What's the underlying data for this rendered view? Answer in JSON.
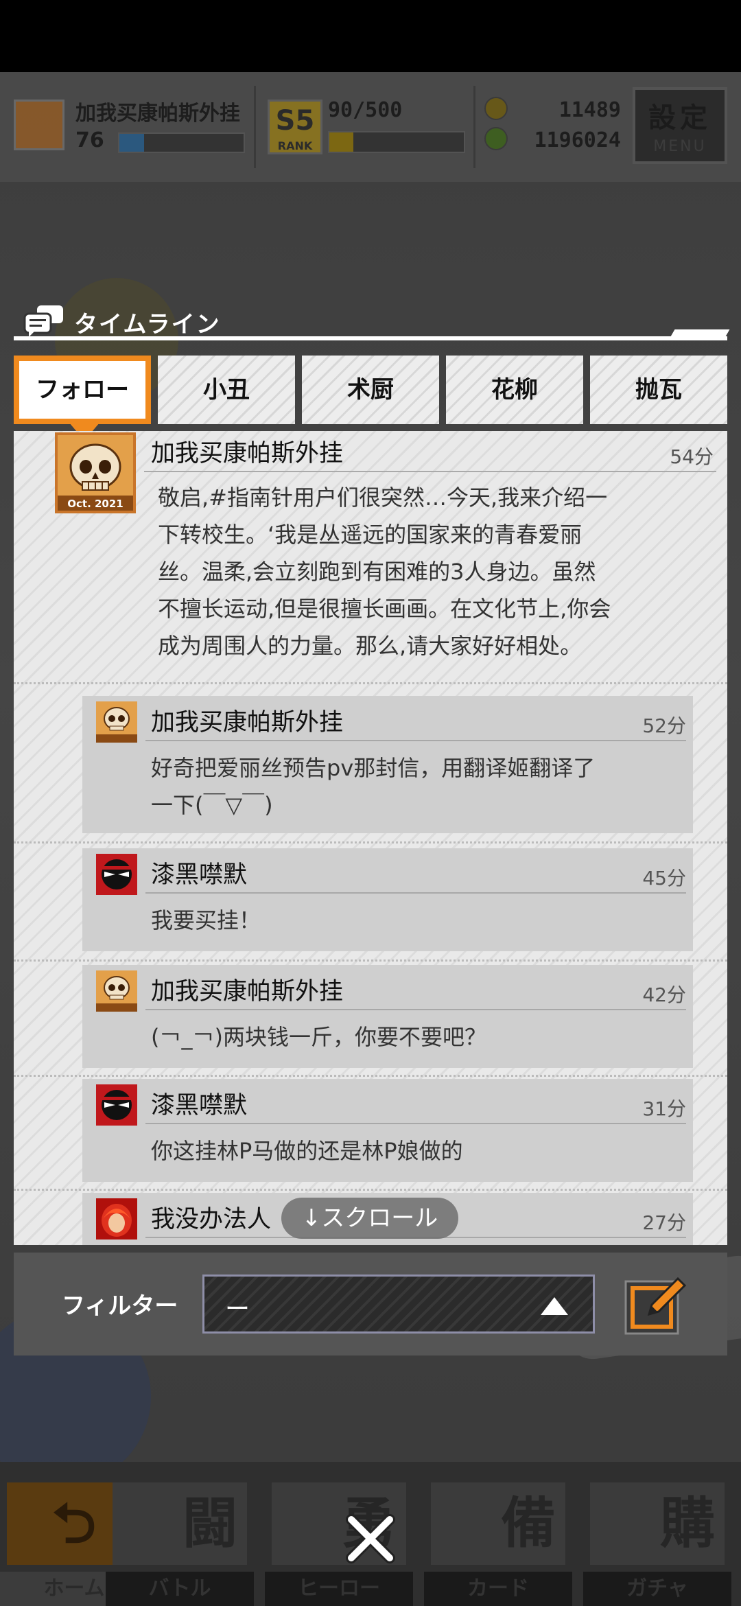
{
  "header": {
    "player_name": "加我买康帕斯外挂",
    "level": "76",
    "rank_progress": "90/500",
    "rank_label": "RANK",
    "rank_badge": "S5",
    "currency_gold": "11489",
    "currency_gems": "1196024",
    "menu_title": "設定",
    "menu_sub": "MENU"
  },
  "timeline": {
    "title": "タイムライン"
  },
  "tabs": [
    {
      "label": "フォロー",
      "active": true
    },
    {
      "label": "小丑",
      "active": false
    },
    {
      "label": "术厨",
      "active": false
    },
    {
      "label": "花柳",
      "active": false
    },
    {
      "label": "抛瓦",
      "active": false
    }
  ],
  "posts": [
    {
      "author": "加我买康帕斯外挂",
      "time": "54分",
      "avatar_caption": "Oct. 2021",
      "lines": [
        "敬启,#指南针用户们很突然…今天,我来介绍一",
        "下转校生。‘我是丛遥远的国家来的青春爱丽",
        "丝。温柔,会立刻跑到有困难的3人身边。虽然",
        "不擅长运动,但是很擅长画画。在文化节上,你会",
        "成为周围人的力量。那么,请大家好好相处。"
      ]
    }
  ],
  "replies": [
    {
      "author": "加我买康帕斯外挂",
      "time": "52分",
      "avatar": "skull",
      "lines": [
        "好奇把爱丽丝预告pv那封信，用翻译姬翻译了",
        "一下(￣▽￣)"
      ]
    },
    {
      "author": "漆黑噤默",
      "time": "45分",
      "avatar": "ninja",
      "lines": [
        "我要买挂！"
      ]
    },
    {
      "author": "加我买康帕斯外挂",
      "time": "42分",
      "avatar": "skull",
      "lines": [
        "(￢_￢)两块钱一斤，你要不要吧？"
      ]
    },
    {
      "author": "漆黑噤默",
      "time": "31分",
      "avatar": "ninja",
      "lines": [
        "你这挂林P马做的还是林P娘做的"
      ]
    },
    {
      "author": "我没办法人",
      "time": "27分",
      "avatar": "redhair",
      "lines": []
    }
  ],
  "scroll_hint": "↓スクロール",
  "filter": {
    "label": "フィルター",
    "value": "ー"
  },
  "bottom_nav": [
    {
      "label": "ホーム",
      "icon": "home-icon",
      "glyph": "⮌"
    },
    {
      "label": "バトル",
      "icon": "battle-icon",
      "glyph": "闘"
    },
    {
      "label": "ヒーロー",
      "icon": "hero-icon",
      "glyph": "勇"
    },
    {
      "label": "カード",
      "icon": "card-icon",
      "glyph": "備"
    },
    {
      "label": "ガチャ",
      "icon": "gacha-icon",
      "glyph": "購"
    }
  ],
  "colors": {
    "accent_orange": "#f08a1e",
    "menu_dark": "#2b2b2b",
    "level_bar": "#2a5a82"
  },
  "progress": {
    "level_exp_fraction": 0.2,
    "rank_fraction": 0.18
  }
}
